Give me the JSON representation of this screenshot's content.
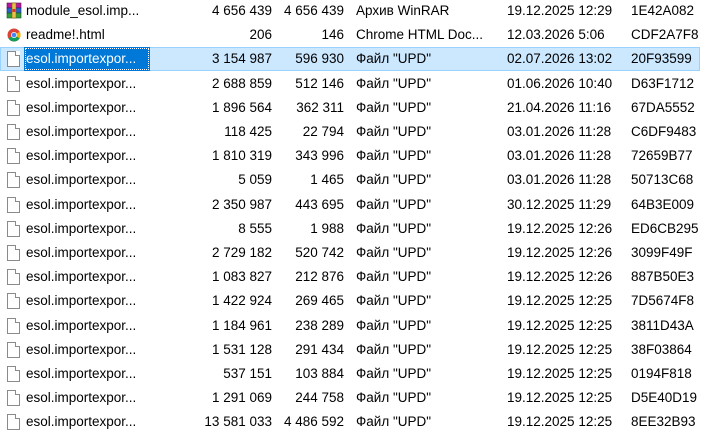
{
  "rows": [
    {
      "icon": "winrar-archive-icon",
      "name": "module_esol.imp...",
      "size": "4 656 439",
      "packed": "4 656 439",
      "type": "Архив WinRAR",
      "modified": "19.12.2025 12:29",
      "crc": "1E42A082"
    },
    {
      "icon": "chrome-html-icon",
      "name": "readme!.html",
      "size": "206",
      "packed": "146",
      "type": "Chrome HTML Doc...",
      "modified": "12.03.2026 5:06",
      "crc": "CDF2A7F8"
    },
    {
      "icon": "file-icon",
      "name": "esol.importexpor...",
      "size": "3 154 987",
      "packed": "596 930",
      "type": "Файл \"UPD\"",
      "modified": "02.07.2026 13:02",
      "crc": "20F93599",
      "selected": true
    },
    {
      "icon": "file-icon",
      "name": "esol.importexpor...",
      "size": "2 688 859",
      "packed": "512 146",
      "type": "Файл \"UPD\"",
      "modified": "01.06.2026 10:40",
      "crc": "D63F1712"
    },
    {
      "icon": "file-icon",
      "name": "esol.importexpor...",
      "size": "1 896 564",
      "packed": "362 311",
      "type": "Файл \"UPD\"",
      "modified": "21.04.2026 11:16",
      "crc": "67DA5552"
    },
    {
      "icon": "file-icon",
      "name": "esol.importexpor...",
      "size": "118 425",
      "packed": "22 794",
      "type": "Файл \"UPD\"",
      "modified": "03.01.2026 11:28",
      "crc": "C6DF9483"
    },
    {
      "icon": "file-icon",
      "name": "esol.importexpor...",
      "size": "1 810 319",
      "packed": "343 996",
      "type": "Файл \"UPD\"",
      "modified": "03.01.2026 11:28",
      "crc": "72659B77"
    },
    {
      "icon": "file-icon",
      "name": "esol.importexpor...",
      "size": "5 059",
      "packed": "1 465",
      "type": "Файл \"UPD\"",
      "modified": "03.01.2026 11:28",
      "crc": "50713C68"
    },
    {
      "icon": "file-icon",
      "name": "esol.importexpor...",
      "size": "2 350 987",
      "packed": "443 695",
      "type": "Файл \"UPD\"",
      "modified": "30.12.2025 11:29",
      "crc": "64B3E009"
    },
    {
      "icon": "file-icon",
      "name": "esol.importexpor...",
      "size": "8 555",
      "packed": "1 988",
      "type": "Файл \"UPD\"",
      "modified": "19.12.2025 12:26",
      "crc": "ED6CB295"
    },
    {
      "icon": "file-icon",
      "name": "esol.importexpor...",
      "size": "2 729 182",
      "packed": "520 742",
      "type": "Файл \"UPD\"",
      "modified": "19.12.2025 12:26",
      "crc": "3099F49F"
    },
    {
      "icon": "file-icon",
      "name": "esol.importexpor...",
      "size": "1 083 827",
      "packed": "212 876",
      "type": "Файл \"UPD\"",
      "modified": "19.12.2025 12:26",
      "crc": "887B50E3"
    },
    {
      "icon": "file-icon",
      "name": "esol.importexpor...",
      "size": "1 422 924",
      "packed": "269 465",
      "type": "Файл \"UPD\"",
      "modified": "19.12.2025 12:25",
      "crc": "7D5674F8"
    },
    {
      "icon": "file-icon",
      "name": "esol.importexpor...",
      "size": "1 184 961",
      "packed": "238 289",
      "type": "Файл \"UPD\"",
      "modified": "19.12.2025 12:25",
      "crc": "3811D43A"
    },
    {
      "icon": "file-icon",
      "name": "esol.importexpor...",
      "size": "1 531 128",
      "packed": "291 434",
      "type": "Файл \"UPD\"",
      "modified": "19.12.2025 12:25",
      "crc": "38F03864"
    },
    {
      "icon": "file-icon",
      "name": "esol.importexpor...",
      "size": "537 151",
      "packed": "103 884",
      "type": "Файл \"UPD\"",
      "modified": "19.12.2025 12:25",
      "crc": "0194F818"
    },
    {
      "icon": "file-icon",
      "name": "esol.importexpor...",
      "size": "1 291 069",
      "packed": "244 758",
      "type": "Файл \"UPD\"",
      "modified": "19.12.2025 12:25",
      "crc": "D5E40D19"
    },
    {
      "icon": "file-icon",
      "name": "esol.importexpor...",
      "size": "13 581 033",
      "packed": "4 486 592",
      "type": "Файл \"UPD\"",
      "modified": "19.12.2025 12:25",
      "crc": "8EE32B93"
    }
  ],
  "colors": {
    "selection_name_bg": "#0078d7",
    "selection_row_bg": "#cce8ff"
  }
}
